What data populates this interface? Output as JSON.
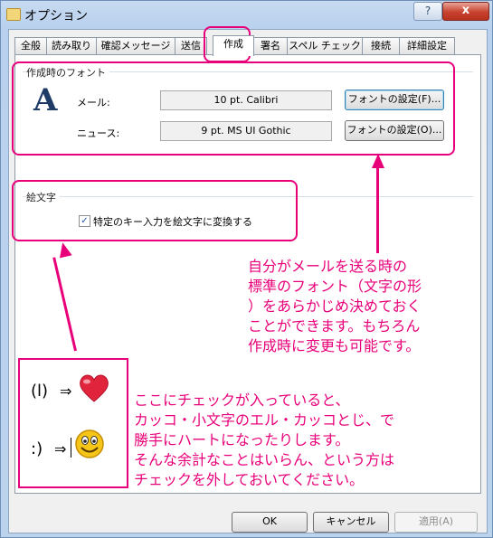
{
  "window": {
    "title": "オプション",
    "help_label": "?",
    "close_label": "x"
  },
  "tabs": [
    {
      "label": "全般"
    },
    {
      "label": "読み取り"
    },
    {
      "label": "確認メッセージ"
    },
    {
      "label": "送信"
    },
    {
      "label": "作成"
    },
    {
      "label": "署名"
    },
    {
      "label": "スペル チェック"
    },
    {
      "label": "接続"
    },
    {
      "label": "詳細設定"
    }
  ],
  "font_group": {
    "title": "作成時のフォント",
    "mail_label": "メール:",
    "mail_value": "10 pt. Calibri",
    "mail_button": "フォントの設定(F)...",
    "news_label": "ニュース:",
    "news_value": "9 pt. MS UI Gothic",
    "news_button": "フォントの設定(O)..."
  },
  "emoji_group": {
    "title": "絵文字",
    "checkbox_label": "特定のキー入力を絵文字に変換する",
    "checked": true
  },
  "annotations": {
    "font_note": [
      "自分がメールを送る時の",
      "標準のフォント（文字の形",
      "）をあらかじめ決めておく",
      "ことができます。もちろん",
      "作成時に変更も可能です。"
    ],
    "emoji_note": [
      "ここにチェックが入っていると、",
      "カッコ・小文字のエル・カッコとじ、で",
      "勝手にハートになったりします。",
      "そんな余計なことはいらん、という方は",
      "チェックを外しておいてください。"
    ],
    "sample_heart_input": "(l)",
    "sample_smile_input": ":)",
    "arrow_glyph": "⇒"
  },
  "footer": {
    "ok": "OK",
    "cancel": "キャンセル",
    "apply": "適用(A)"
  },
  "colors": {
    "annotation": "#e8007a",
    "heart": "#e0243b",
    "smiley": "#f5c518"
  }
}
